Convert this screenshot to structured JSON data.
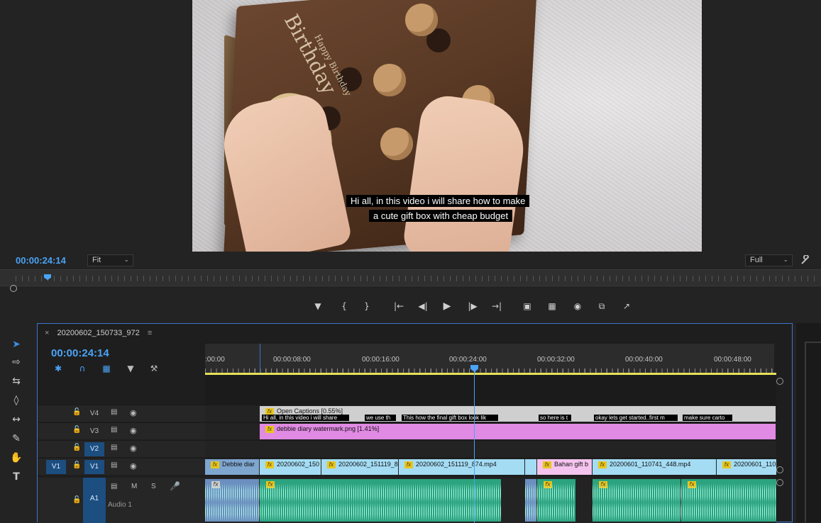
{
  "monitor": {
    "timecode": "00:00:24:14",
    "zoom_select": "Fit",
    "resolution_select": "Full",
    "video": {
      "box_text_birthday": "Birthday",
      "box_text_happy_birthday": "Happy Birthday",
      "caption_line1": "Hi all, in this video i will share how to make",
      "caption_line2": "a cute gift box with cheap budget"
    },
    "transport": [
      "marker-icon",
      "mark-in-icon",
      "mark-out-icon",
      "go-to-in-icon",
      "step-back-icon",
      "play-icon",
      "step-forward-icon",
      "go-to-out-icon",
      "lift-icon",
      "extract-icon",
      "export-frame-icon",
      "comparison-icon",
      "share-icon"
    ]
  },
  "tools": [
    "selection-tool-icon",
    "track-select-tool-icon",
    "ripple-edit-tool-icon",
    "razor-tool-icon",
    "slip-tool-icon",
    "pen-tool-icon",
    "hand-tool-icon",
    "type-tool-icon"
  ],
  "timeline": {
    "sequence_name": "20200602_150733_972",
    "timecode": "00:00:24:14",
    "ruler_labels": [
      ":00:00",
      "00:00:08:00",
      "00:00:16:00",
      "00:00:24:00",
      "00:00:32:00",
      "00:00:40:00",
      "00:00:48:00"
    ],
    "tracks": {
      "v4": "V4",
      "v3": "V3",
      "v2": "V2",
      "v1": "V1",
      "v1_source": "V1",
      "a1": "A1",
      "a1_name": "Audio 1",
      "a1_mute": "M",
      "a1_solo": "S"
    },
    "clips": {
      "captions": "Open Captions [0.55%]",
      "watermark": "debbie diary watermark.png [1.41%]",
      "v1": [
        "Debbie diar",
        "20200602_150",
        "20200602_151119_87",
        "20200602_151119_874.mp4",
        "Bahan gift b",
        "20200601_110741_448.mp4",
        "20200601_1107"
      ]
    },
    "caption_segments": [
      "Hi all, in this video i will share",
      "we use th",
      "This how the final gift box look lik",
      "so here is t",
      "okay lets get started..first m",
      "make sure carto"
    ],
    "colors": {
      "accent": "#4aa3f5",
      "caption_track": "#cfcfcf",
      "graphic_clip": "#e08ae3",
      "video_clip": "#a4dcf4",
      "video_clip_pink": "#f5c4ee",
      "video_clip_dark": "#7ea6cf",
      "audio_clip": "#2ba37f",
      "work_area": "#e6e05a"
    }
  }
}
